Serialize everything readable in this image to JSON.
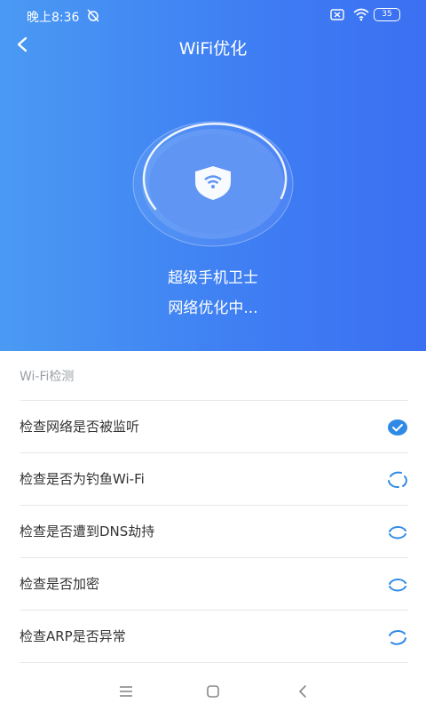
{
  "status_bar": {
    "time": "晚上8:36",
    "battery": "35"
  },
  "header": {
    "title": "WiFi优化"
  },
  "hero": {
    "app_name": "超级手机卫士",
    "status": "网络优化中..."
  },
  "section": {
    "title": "Wi-Fi检测"
  },
  "checks": [
    {
      "label": "检查网络是否被监听",
      "state": "done"
    },
    {
      "label": "检查是否为钓鱼Wi-Fi",
      "state": "loading"
    },
    {
      "label": "检查是否遭到DNS劫持",
      "state": "loading"
    },
    {
      "label": "检查是否加密",
      "state": "loading"
    },
    {
      "label": "检查ARP是否异常",
      "state": "loading"
    }
  ],
  "colors": {
    "accent": "#2f8ae5",
    "gradient_start": "#4a9af3",
    "gradient_end": "#3b70f2"
  },
  "icons": {
    "back": "back-arrow-icon",
    "shield": "shield-wifi-icon",
    "done": "check-circle-icon",
    "loading": "loading-ring-icon",
    "nav_menu": "menu-icon",
    "nav_home": "home-icon",
    "nav_back": "back-icon"
  }
}
